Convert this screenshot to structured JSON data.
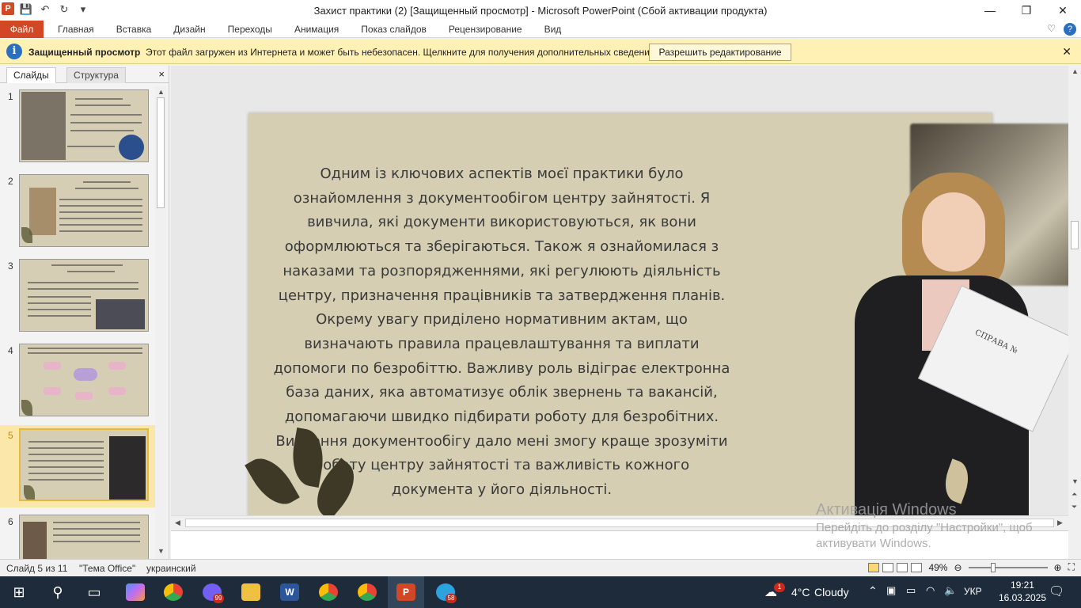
{
  "window": {
    "title": "Захист практики (2) [Защищенный просмотр]  -  Microsoft PowerPoint (Сбой активации продукта)",
    "app_icon": "P"
  },
  "ribbon": {
    "file_tab": "Файл",
    "tabs": [
      "Главная",
      "Вставка",
      "Дизайн",
      "Переходы",
      "Анимация",
      "Показ слайдов",
      "Рецензирование",
      "Вид"
    ]
  },
  "protected_bar": {
    "title": "Защищенный просмотр",
    "message": "Этот файл загружен из Интернета и может быть небезопасен. Щелкните для получения дополнительных сведений.",
    "button": "Разрешить редактирование"
  },
  "left_pane": {
    "tabs": [
      "Слайды",
      "Структура"
    ],
    "close": "×",
    "slides": [
      {
        "number": "1",
        "selected": false
      },
      {
        "number": "2",
        "selected": false
      },
      {
        "number": "3",
        "selected": false
      },
      {
        "number": "4",
        "selected": false
      },
      {
        "number": "5",
        "selected": true
      },
      {
        "number": "6",
        "selected": false
      }
    ]
  },
  "slide": {
    "text": "Одним із ключових аспектів моєї практики було ознайомлення з документообігом центру зайнятості. Я вивчила, які документи використовуються, як вони оформлюються та зберігаються. Також я ознайомилася з наказами та розпорядженнями, які регулюють діяльність центру, призначення працівників та затвердження планів. Окрему увагу приділено нормативним актам, що визначають правила працевлаштування та виплати допомоги по безробіттю. Важливу роль відіграє електронна база даних, яка автоматизує облік звернень та вакансій, допомагаючи швидко підбирати роботу для безробітних. Вивчення документообігу дало мені змогу краще зрозуміти роботу центру зайнятості та важливість кожного документа у його діяльності.",
    "paper_label": "СПРАВА №",
    "background_color": "#d5ceb2"
  },
  "watermark": {
    "line1": "Активація Windows",
    "line2": "Перейдіть до розділу \"Настройки\", щоб",
    "line3": "активувати Windows."
  },
  "status": {
    "slide_info": "Слайд 5 из 11",
    "theme": "\"Тема Office\"",
    "language": "украинский",
    "zoom": "49%"
  },
  "taskbar": {
    "weather_temp": "4°C",
    "weather_desc": "Cloudy",
    "weather_badge": "1",
    "viber_badge": "99",
    "telegram_badge": "58",
    "lang": "УКР",
    "time": "19:21",
    "date": "16.03.2025"
  }
}
